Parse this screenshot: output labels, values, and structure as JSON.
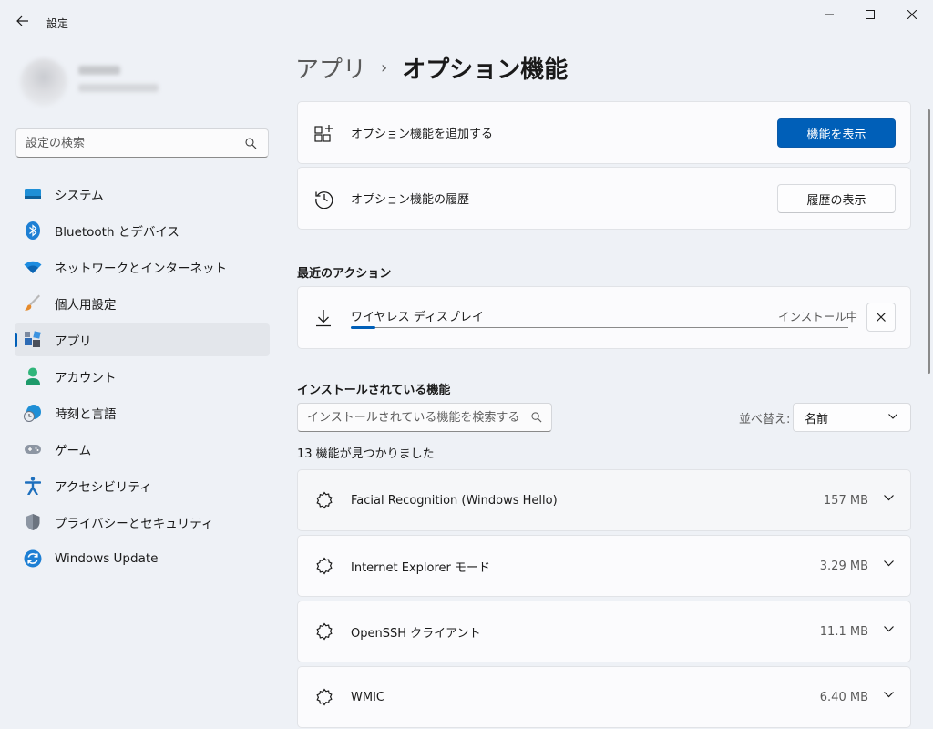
{
  "window": {
    "title": "設定"
  },
  "sidebar": {
    "search_placeholder": "設定の検索",
    "items": [
      {
        "label": "システム",
        "icon": "system-icon"
      },
      {
        "label": "Bluetooth とデバイス",
        "icon": "bluetooth-icon"
      },
      {
        "label": "ネットワークとインターネット",
        "icon": "wifi-icon"
      },
      {
        "label": "個人用設定",
        "icon": "brush-icon"
      },
      {
        "label": "アプリ",
        "icon": "apps-icon",
        "active": true
      },
      {
        "label": "アカウント",
        "icon": "account-icon"
      },
      {
        "label": "時刻と言語",
        "icon": "clock-globe-icon"
      },
      {
        "label": "ゲーム",
        "icon": "gamepad-icon"
      },
      {
        "label": "アクセシビリティ",
        "icon": "accessibility-icon"
      },
      {
        "label": "プライバシーとセキュリティ",
        "icon": "shield-icon"
      },
      {
        "label": "Windows Update",
        "icon": "update-icon"
      }
    ]
  },
  "breadcrumb": {
    "parent": "アプリ",
    "separator": "›",
    "current": "オプション機能"
  },
  "add_feature": {
    "label": "オプション機能を追加する",
    "button": "機能を表示"
  },
  "history": {
    "label": "オプション機能の履歴",
    "button": "履歴の表示"
  },
  "recent_actions": {
    "title": "最近のアクション",
    "item": {
      "name": "ワイヤレス ディスプレイ",
      "status": "インストール中",
      "progress": 0.05
    }
  },
  "installed": {
    "title": "インストールされている機能",
    "search_placeholder": "インストールされている機能を検索する",
    "sort_label": "並べ替え:",
    "sort_value": "名前",
    "count_text": "13 機能が見つかりました",
    "features": [
      {
        "name": "Facial Recognition (Windows Hello)",
        "size": "157 MB"
      },
      {
        "name": "Internet Explorer モード",
        "size": "3.29 MB"
      },
      {
        "name": "OpenSSH クライアント",
        "size": "11.1 MB"
      },
      {
        "name": "WMIC",
        "size": "6.40 MB"
      }
    ]
  },
  "colors": {
    "accent": "#005fb8",
    "background": "#eef1f6",
    "card": "#fbfbfd"
  }
}
